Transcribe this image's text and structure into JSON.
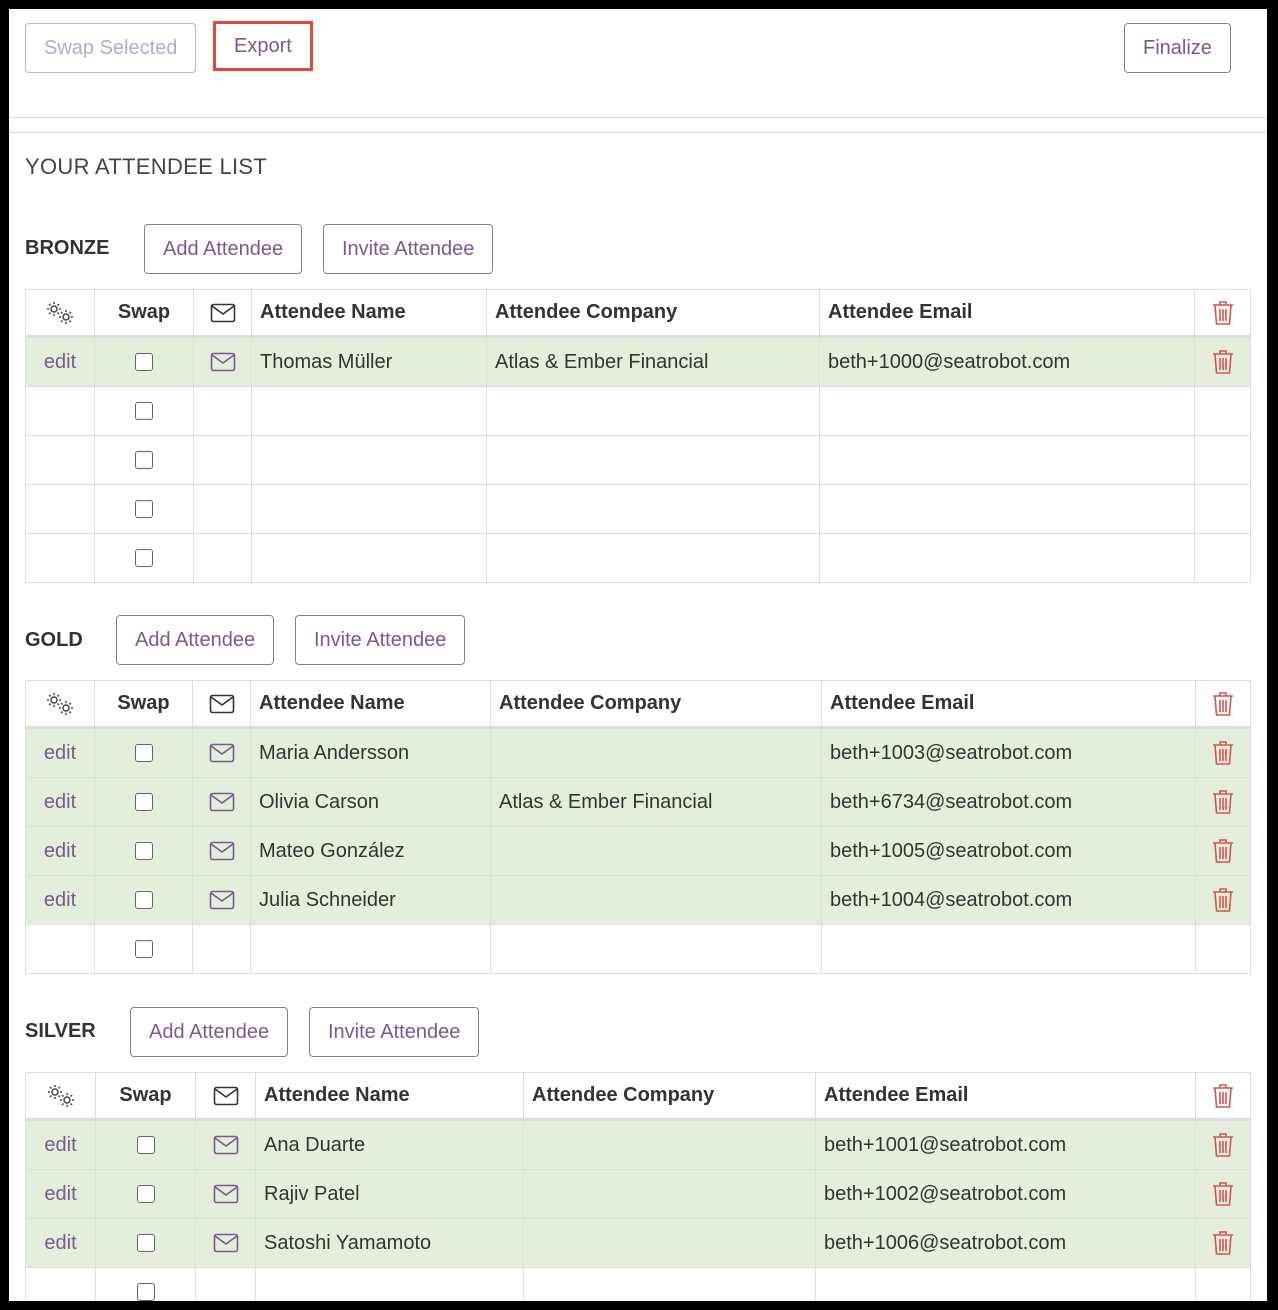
{
  "toolbar": {
    "swap_selected": "Swap Selected",
    "export": "Export",
    "finalize": "Finalize"
  },
  "list_title": "YOUR ATTENDEE LIST",
  "columns": {
    "swap": "Swap",
    "name": "Attendee Name",
    "company": "Attendee Company",
    "email": "Attendee Email"
  },
  "row_action": "edit",
  "tiers": [
    {
      "label": "BRONZE",
      "add_label": "Add Attendee",
      "invite_label": "Invite Attendee",
      "rows": [
        {
          "name": "Thomas Müller",
          "company": "Atlas & Ember Financial",
          "email": "beth+1000@seatrobot.com"
        }
      ],
      "empty_rows": 4
    },
    {
      "label": "GOLD",
      "add_label": "Add Attendee",
      "invite_label": "Invite Attendee",
      "rows": [
        {
          "name": "Maria Andersson",
          "company": "",
          "email": "beth+1003@seatrobot.com"
        },
        {
          "name": "Olivia Carson",
          "company": "Atlas & Ember Financial",
          "email": "beth+6734@seatrobot.com"
        },
        {
          "name": "Mateo González",
          "company": "",
          "email": "beth+1005@seatrobot.com"
        },
        {
          "name": "Julia Schneider",
          "company": "",
          "email": "beth+1004@seatrobot.com"
        }
      ],
      "empty_rows": 1
    },
    {
      "label": "SILVER",
      "add_label": "Add Attendee",
      "invite_label": "Invite Attendee",
      "rows": [
        {
          "name": "Ana Duarte",
          "company": "",
          "email": "beth+1001@seatrobot.com"
        },
        {
          "name": "Rajiv Patel",
          "company": "",
          "email": "beth+1002@seatrobot.com"
        },
        {
          "name": "Satoshi Yamamoto",
          "company": "",
          "email": "beth+1006@seatrobot.com"
        }
      ],
      "empty_rows": 1
    }
  ],
  "colors": {
    "accent": "#7a5a8e",
    "row_fill": "#e3efdc",
    "delete": "#d9534f",
    "highlight": "#e14a36"
  }
}
